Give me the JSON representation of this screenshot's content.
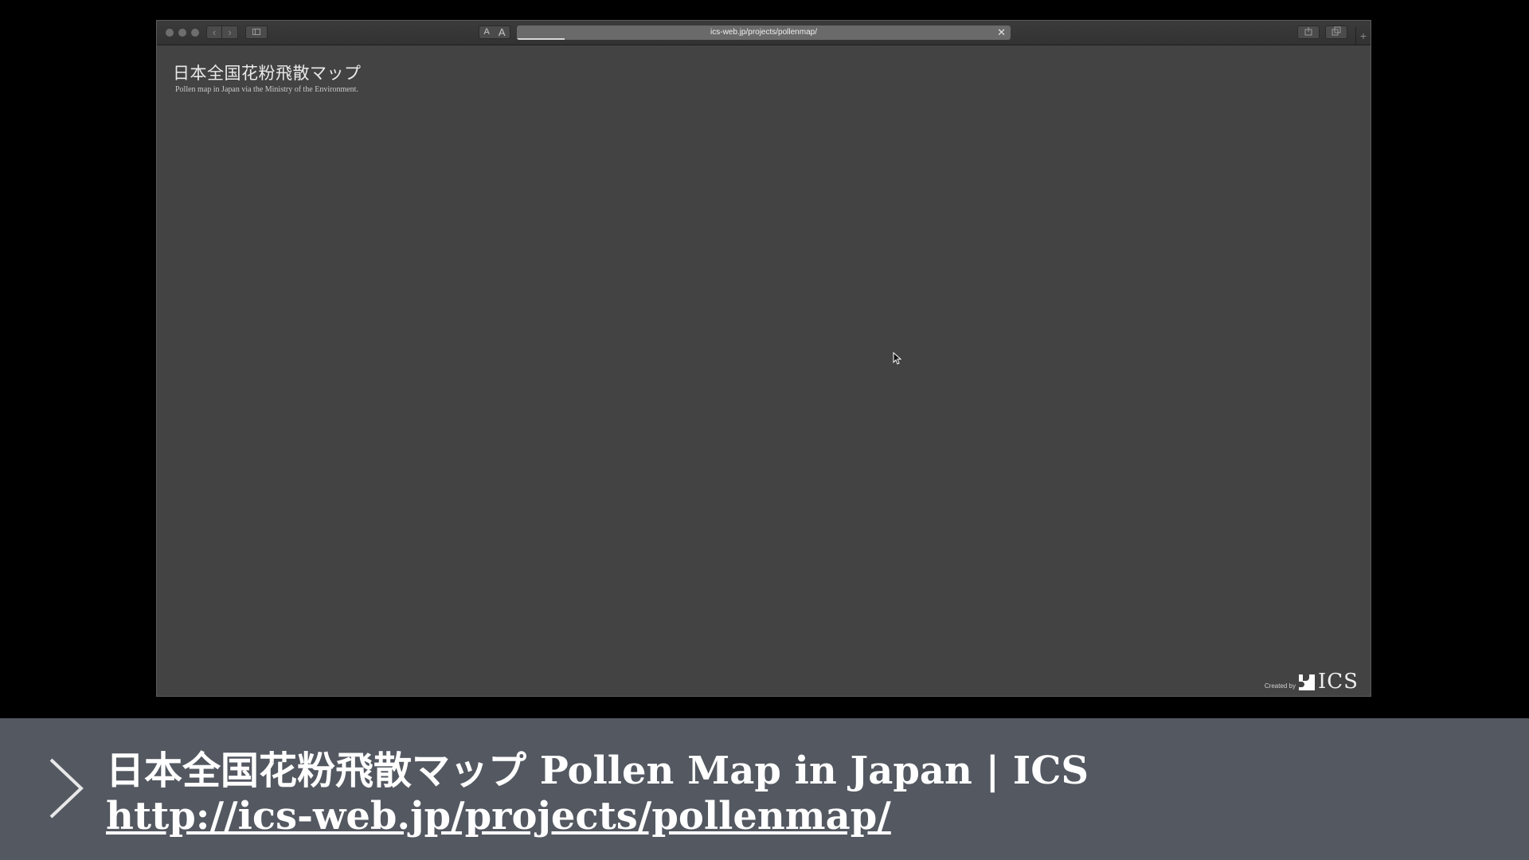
{
  "browser": {
    "address_url": "ics-web.jp/projects/pollenmap/",
    "reader_small": "A",
    "reader_large": "A",
    "clear_symbol": "✕",
    "nav_back": "‹",
    "nav_forward": "›",
    "new_tab": "+"
  },
  "page": {
    "title": "日本全国花粉飛散マップ",
    "subtitle": "Pollen map in Japan via the Ministry of the Environment.",
    "credit_prefix": "Created by",
    "credit_brand": "ICS"
  },
  "caption": {
    "title": "日本全国花粉飛散マップ Pollen Map in Japan | ICS",
    "link": "http://ics-web.jp/projects/pollenmap/"
  },
  "colors": {
    "page_background": "#434343",
    "caption_background": "#535861"
  },
  "icons": [
    "chevron-right-icon",
    "sidebar-icon",
    "share-icon",
    "tabs-icon",
    "mouse-cursor-icon",
    "ics-logo-icon"
  ]
}
